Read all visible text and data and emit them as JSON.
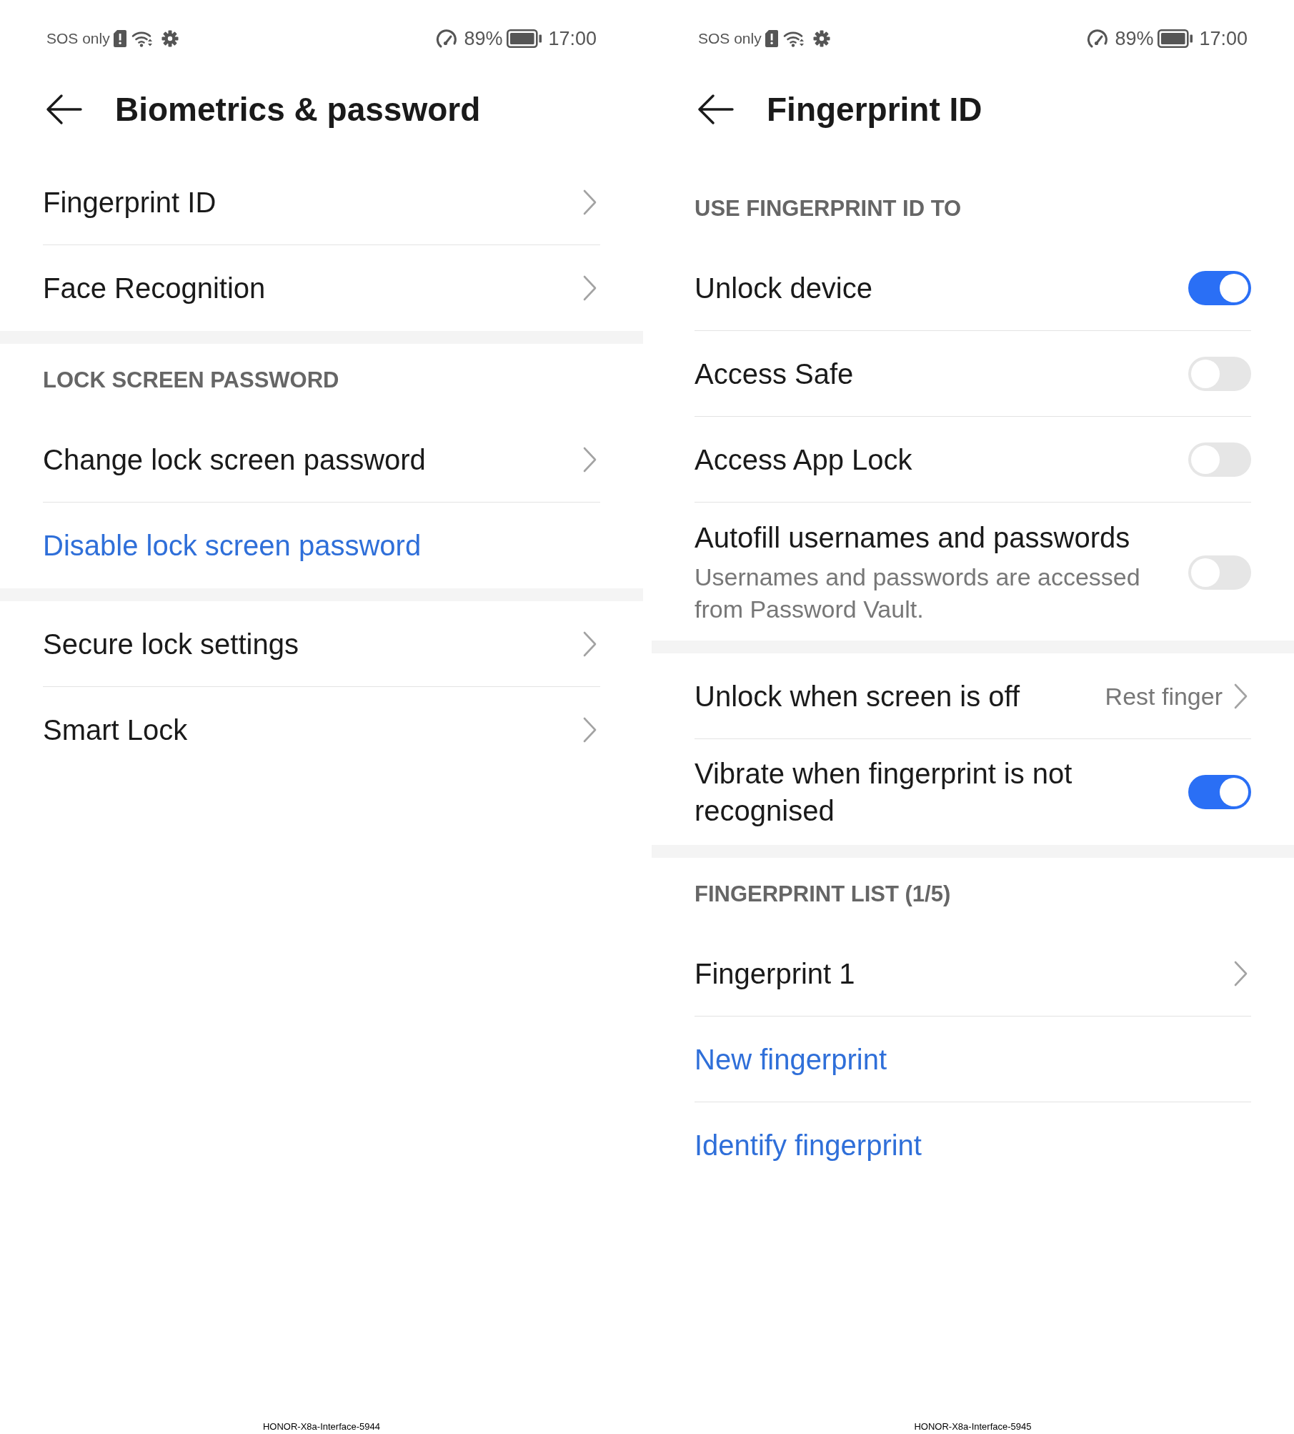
{
  "screens": [
    {
      "status_bar": {
        "carrier": "SOS only",
        "battery": "89%",
        "time": "17:00"
      },
      "title": "Biometrics & password",
      "groups": [
        {
          "items": [
            {
              "kind": "nav",
              "label": "Fingerprint ID"
            },
            {
              "kind": "nav",
              "label": "Face Recognition"
            }
          ]
        },
        {
          "header": "LOCK SCREEN PASSWORD",
          "items": [
            {
              "kind": "nav",
              "label": "Change lock screen password"
            },
            {
              "kind": "action",
              "label": "Disable lock screen password"
            }
          ]
        },
        {
          "items": [
            {
              "kind": "nav",
              "label": "Secure lock settings"
            },
            {
              "kind": "nav",
              "label": "Smart Lock"
            }
          ]
        }
      ],
      "caption": "HONOR-X8a-Interface-5944"
    },
    {
      "status_bar": {
        "carrier": "SOS only",
        "battery": "89%",
        "time": "17:00"
      },
      "title": "Fingerprint ID",
      "groups": [
        {
          "header": "USE FINGERPRINT ID TO",
          "items": [
            {
              "kind": "toggle",
              "label": "Unlock device",
              "on": true
            },
            {
              "kind": "toggle",
              "label": "Access Safe",
              "on": false
            },
            {
              "kind": "toggle",
              "label": "Access App Lock",
              "on": false
            },
            {
              "kind": "toggle",
              "label": "Autofill usernames and passwords",
              "description": "Usernames and passwords are accessed from Password Vault.",
              "on": false
            }
          ]
        },
        {
          "items": [
            {
              "kind": "nav",
              "label": "Unlock when screen is off",
              "value": "Rest finger"
            },
            {
              "kind": "toggle",
              "label": "Vibrate when fingerprint is not recognised",
              "on": true
            }
          ]
        },
        {
          "header": "FINGERPRINT LIST (1/5)",
          "items": [
            {
              "kind": "nav",
              "label": "Fingerprint 1"
            },
            {
              "kind": "action",
              "label": "New fingerprint"
            },
            {
              "kind": "action",
              "label": "Identify fingerprint"
            }
          ]
        }
      ],
      "caption": "HONOR-X8a-Interface-5945"
    }
  ]
}
